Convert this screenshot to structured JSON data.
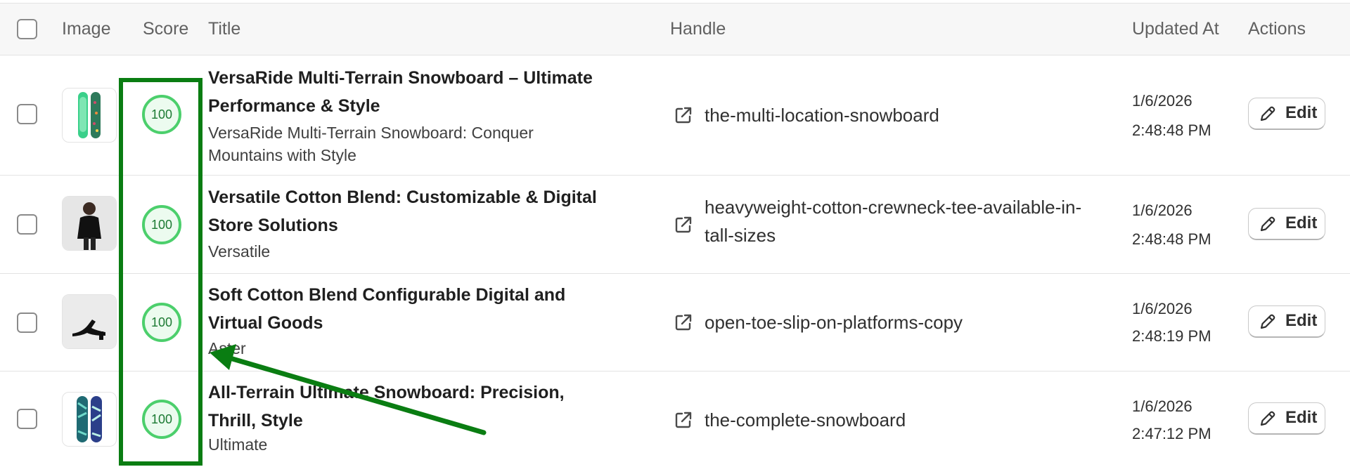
{
  "headers": {
    "image": "Image",
    "score": "Score",
    "title": "Title",
    "handle": "Handle",
    "updated_at": "Updated At",
    "actions": "Actions"
  },
  "rows": [
    {
      "score": "100",
      "title": "VersaRide Multi-Terrain Snowboard – Ultimate Performance & Style",
      "subtitle": "VersaRide Multi-Terrain Snowboard: Conquer Mountains with Style",
      "handle": "the-multi-location-snowboard",
      "date": "1/6/2026",
      "time": "2:48:48 PM",
      "edit_label": "Edit",
      "image": "snowboard-green-thumbnail"
    },
    {
      "score": "100",
      "title": "Versatile Cotton Blend: Customizable & Digital Store Solutions",
      "subtitle": "Versatile",
      "handle": "heavyweight-cotton-crewneck-tee-available-in-tall-sizes",
      "date": "1/6/2026",
      "time": "2:48:48 PM",
      "edit_label": "Edit",
      "image": "black-tee-model-thumbnail"
    },
    {
      "score": "100",
      "title": "Soft Cotton Blend Configurable Digital and Virtual Goods",
      "subtitle": "Aster",
      "handle": "open-toe-slip-on-platforms-copy",
      "date": "1/6/2026",
      "time": "2:48:19 PM",
      "edit_label": "Edit",
      "image": "black-sandal-thumbnail"
    },
    {
      "score": "100",
      "title": "All-Terrain Ultimate Snowboard: Precision, Thrill, Style",
      "subtitle": "Ultimate",
      "handle": "the-complete-snowboard",
      "date": "1/6/2026",
      "time": "2:47:12 PM",
      "edit_label": "Edit",
      "image": "snowboard-teal-pattern-thumbnail"
    }
  ],
  "annotation": {
    "highlight_color": "#0a7d12",
    "highlight_target": "score-column",
    "arrow_color": "#0a7d12"
  },
  "icons": {
    "row_link": "external-link-icon",
    "edit": "pencil-icon"
  }
}
